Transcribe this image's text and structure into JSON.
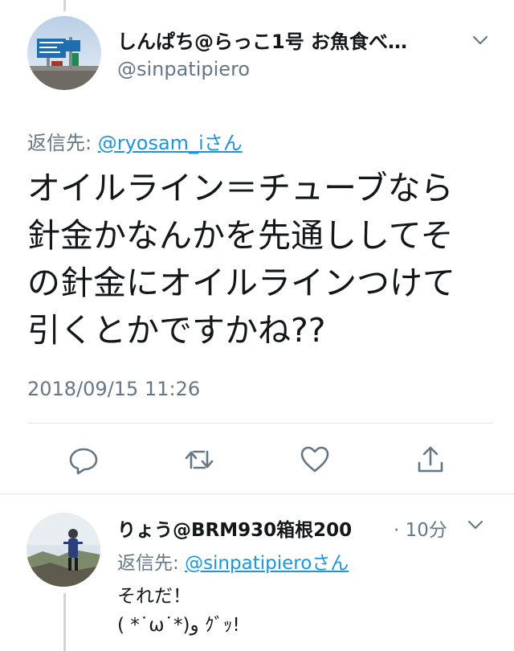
{
  "main_tweet": {
    "display_name": "しんぱち@らっこ1号 お魚食べ…",
    "handle": "@sinpatipiero",
    "reply_prefix": "返信先: ",
    "reply_mention": "@ryosam_iさん",
    "text": "オイルライン＝チューブなら\n針金かなんかを先通ししてそ\nの針金にオイルラインつけて\n引くとかですかね??",
    "timestamp": "2018/09/15 11:26"
  },
  "actions": {
    "reply_icon": "reply-icon",
    "retweet_icon": "retweet-icon",
    "like_icon": "heart-icon",
    "share_icon": "share-icon"
  },
  "reply_tweet": {
    "display_name": "りょう@BRM930箱根200",
    "time": "· 10分",
    "reply_prefix": "返信先: ",
    "reply_mention": "@sinpatipieroさん",
    "text": "それだ！\n( *˙ω˙*)و ｸﾞｯ!"
  },
  "colors": {
    "accent": "#1b95e0",
    "secondary_text": "#657786",
    "divider": "#e1e8ed",
    "thread_line": "#ccd6dd"
  }
}
